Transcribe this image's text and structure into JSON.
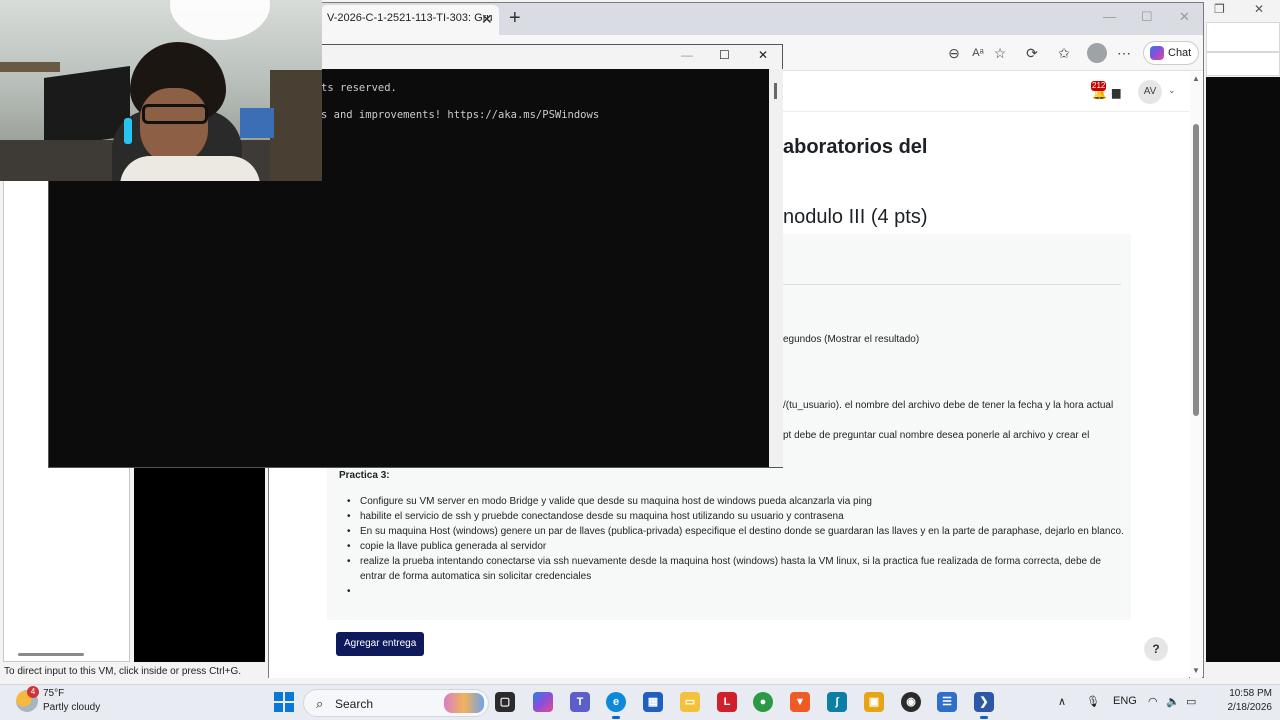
{
  "vm_host": {
    "status_text": "To direct input to this VM, click inside or press Ctrl+G."
  },
  "browser": {
    "tab_title": "V-2026-C-1-2521-113-TI-303: Gru",
    "chat_label": "Chat",
    "notification_count": "212",
    "user_initials": "AV",
    "page_title_fragment": "aboratorios del",
    "section_title_fragment": "nodulo III (4 pts)",
    "partial_lines": {
      "line1": "egundos (Mostrar el resultado)",
      "line2": "/(tu_usuario). el nombre del archivo debe de tener la fecha y la hora actual",
      "line3": "pt debe de preguntar cual nombre desea ponerle al archivo y crear el"
    },
    "practica_heading": "Practica 3:",
    "bullets": [
      "Configure su VM server en modo Bridge y valide que desde su maquina host de windows pueda alcanzarla via ping",
      "habilite el servicio de ssh y pruebde conectandose desde su maquina host utilizando su usuario y contrasena",
      "En su maquina Host (windows) genere un par de llaves (publica-privada) especifique el destino donde se guardaran las llaves y en la parte de paraphase, dejarlo en blanco.",
      "copie la llave publica generada al servidor",
      "realize la prueba intentando conectarse via ssh nuevamente desde la maquina host (windows) hasta la VM linux, si la practica fue realizada de forma correcta, debe de entrar de forma automatica sin solicitar credenciales",
      ""
    ],
    "submit_label": "Agregar entrega",
    "help_label": "?"
  },
  "terminal": {
    "line1": "ts reserved.",
    "line2": "s and improvements! https://aka.ms/PSWindows"
  },
  "taskbar": {
    "weather_temp": "75°F",
    "weather_desc": "Partly cloudy",
    "weather_badge": "4",
    "search_label": "Search",
    "language": "ENG",
    "time": "10:58 PM",
    "date": "2/18/2026"
  },
  "icons": [
    "search-icon",
    "read-aloud-icon",
    "favorite-icon",
    "refresh-icon",
    "favorites-icon",
    "profile-icon",
    "more-icon",
    "notification-bell-icon",
    "message-icon",
    "windows-start-icon",
    "microphone-icon",
    "wifi-icon",
    "volume-icon",
    "battery-icon"
  ],
  "colors": {
    "submit_button": "#0f1a5c",
    "terminal_bg": "#0c0c0c",
    "taskbar_bg": "#e8ecf2",
    "accent_blue": "#0a78d7"
  }
}
